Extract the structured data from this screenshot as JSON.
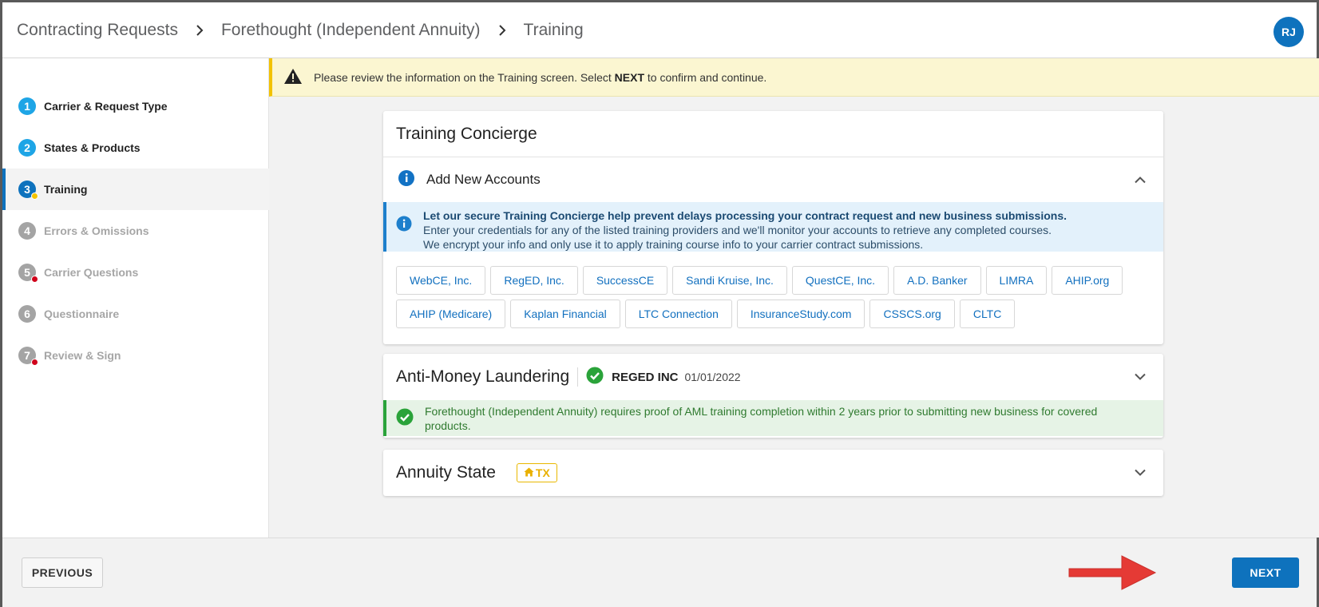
{
  "breadcrumb": [
    "Contracting Requests",
    "Forethought (Independent Annuity)",
    "Training"
  ],
  "user": {
    "initials": "RJ"
  },
  "steps": [
    {
      "num": "1",
      "label": "Carrier & Request Type",
      "state": "done"
    },
    {
      "num": "2",
      "label": "States & Products",
      "state": "done"
    },
    {
      "num": "3",
      "label": "Training",
      "state": "current"
    },
    {
      "num": "4",
      "label": "Errors & Omissions",
      "state": "todo"
    },
    {
      "num": "5",
      "label": "Carrier Questions",
      "state": "todo"
    },
    {
      "num": "6",
      "label": "Questionnaire",
      "state": "todo"
    },
    {
      "num": "7",
      "label": "Review & Sign",
      "state": "todo"
    }
  ],
  "alert": {
    "before": "Please review the information on the Training screen. Select ",
    "bold": "NEXT",
    "after": " to confirm and continue."
  },
  "concierge": {
    "title": "Training Concierge",
    "section_label": "Add New Accounts",
    "info_line1": "Let our secure Training Concierge help prevent delays processing your contract request and new business submissions.",
    "info_line2": "Enter your credentials for any of the listed training providers and we'll monitor your accounts to retrieve any completed courses.",
    "info_line3": "We encrypt your info and only use it to apply training course info to your carrier contract submissions.",
    "providers": [
      "WebCE, Inc.",
      "RegED, Inc.",
      "SuccessCE",
      "Sandi Kruise, Inc.",
      "QuestCE, Inc.",
      "A.D. Banker",
      "LIMRA",
      "AHIP.org",
      "AHIP (Medicare)",
      "Kaplan Financial",
      "LTC Connection",
      "InsuranceStudy.com",
      "CSSCS.org",
      "CLTC"
    ]
  },
  "aml": {
    "title": "Anti-Money Laundering",
    "provider": "REGED INC",
    "date": "01/01/2022",
    "message": "Forethought (Independent Annuity) requires proof of AML training completion within 2 years prior to submitting new business for covered products."
  },
  "annuity": {
    "title": "Annuity State",
    "state": "TX"
  },
  "footer": {
    "previous_label": "PREVIOUS",
    "next_label": "NEXT"
  },
  "colors": {
    "primary": "#0e72bd",
    "warning": "#f2c200",
    "success": "#2aa33a",
    "error_dot": "#d0021b"
  }
}
